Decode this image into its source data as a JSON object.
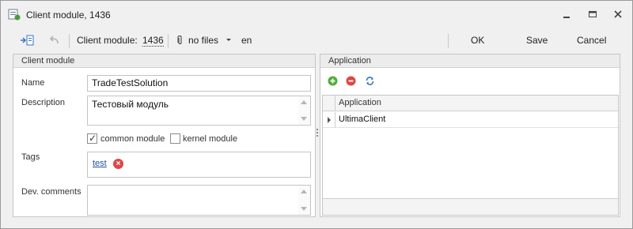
{
  "window": {
    "title": "Client module, 1436",
    "icon": "module-app-icon",
    "controls": [
      "minimize-icon",
      "maximize-icon",
      "close-icon"
    ]
  },
  "toolbar": {
    "module_label": "Client module:",
    "module_id": "1436",
    "files_label": "no files",
    "language": "en",
    "ok_label": "OK",
    "save_label": "Save",
    "cancel_label": "Cancel"
  },
  "client_module": {
    "title": "Client module",
    "name_label": "Name",
    "name_value": "TradeTestSolution",
    "description_label": "Description",
    "description_value": "Тестовый модуль",
    "common_module_label": "common module",
    "common_module_checked": true,
    "kernel_module_label": "kernel module",
    "kernel_module_checked": false,
    "tags_label": "Tags",
    "tags": [
      "test"
    ],
    "dev_comments_label": "Dev. comments",
    "dev_comments_value": ""
  },
  "application": {
    "title": "Application",
    "toolbar_icons": [
      "add-icon",
      "remove-icon",
      "refresh-icon"
    ],
    "grid": {
      "columns": [
        "Application"
      ],
      "rows": [
        [
          "UltimaClient"
        ]
      ]
    }
  }
}
